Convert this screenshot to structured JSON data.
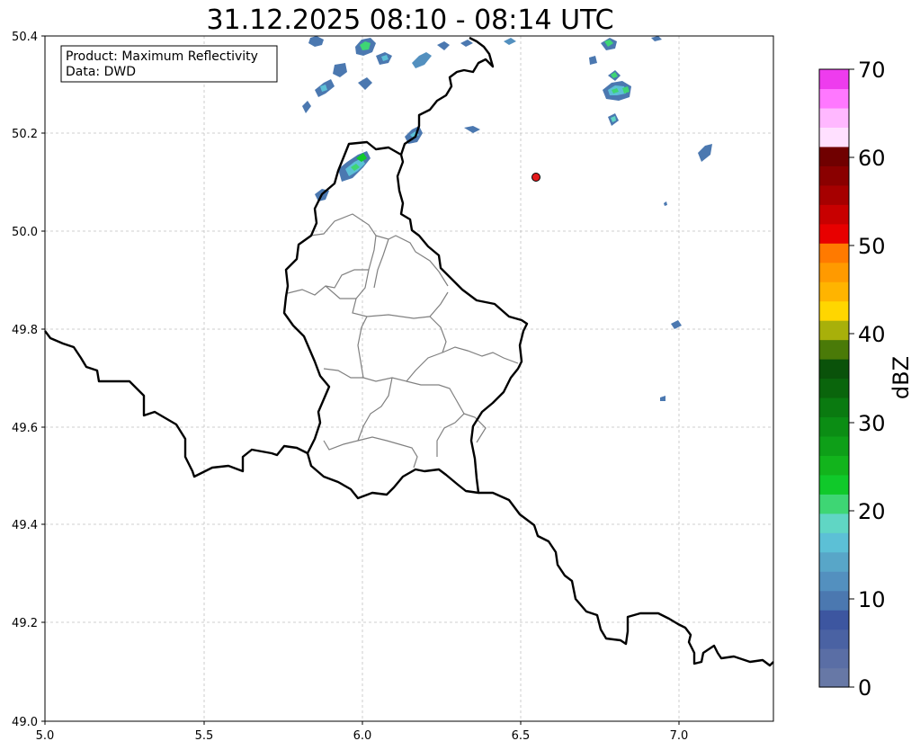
{
  "title": "31.12.2025 08:10 - 08:14 UTC",
  "info_box": {
    "line1": "Product: Maximum Reflectivity",
    "line2": "Data: DWD"
  },
  "colorbar": {
    "label": "dBZ",
    "tick_labels": [
      "0",
      "10",
      "20",
      "30",
      "40",
      "50",
      "60",
      "70"
    ],
    "range": [
      0,
      70
    ],
    "step": 2.5,
    "colors": [
      "#6778a6",
      "#5a6ea5",
      "#4a62a3",
      "#3d56a0",
      "#4b78b0",
      "#5390bf",
      "#58a6c8",
      "#5cc0d6",
      "#60d6c4",
      "#3ed674",
      "#10c92a",
      "#12b41c",
      "#0e9f18",
      "#0b8d14",
      "#0a7a10",
      "#0a650c",
      "#0a520a",
      "#4a7a08",
      "#a8b00a",
      "#ffd600",
      "#ffb400",
      "#ff9a00",
      "#ff7a00",
      "#e80000",
      "#c80000",
      "#a60000",
      "#8a0000",
      "#700000",
      "#ffe0ff",
      "#ffb8ff",
      "#ff78ff",
      "#ee3cee"
    ]
  },
  "axes": {
    "xlim": [
      5.0,
      7.3
    ],
    "ylim": [
      49.0,
      50.4
    ],
    "x_tick_labels": [
      "5.0",
      "5.5",
      "6.0",
      "6.5",
      "7.0"
    ],
    "y_tick_labels": [
      "49.0",
      "49.2",
      "49.4",
      "49.6",
      "49.8",
      "50.0",
      "50.2",
      "50.4"
    ],
    "grid": true
  },
  "marker": {
    "lon": 6.55,
    "lat": 50.11,
    "color": "#e31a1c"
  },
  "colors": {
    "border": "#000000",
    "district_border": "#808080",
    "grid": "#c0c0c0"
  }
}
